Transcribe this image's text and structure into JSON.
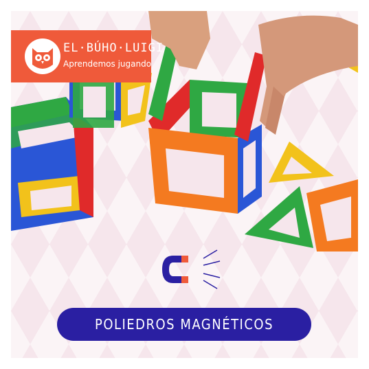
{
  "brand": {
    "name": "EL·BÚHO·LUIGI",
    "tagline": "Aprendemos jugando",
    "logo_icon": "owl-icon",
    "color": "#ef5a3a"
  },
  "photo": {
    "subject": "magnetic-tile-polyhedra",
    "tile_colors": [
      "#2a56d6",
      "#f2c21b",
      "#2fa843",
      "#f47a20",
      "#e02a2a"
    ]
  },
  "magnet_icon": "magnet-icon",
  "title": {
    "text": "POLIEDROS MAGNÉTICOS",
    "background": "#2a1fa2"
  }
}
